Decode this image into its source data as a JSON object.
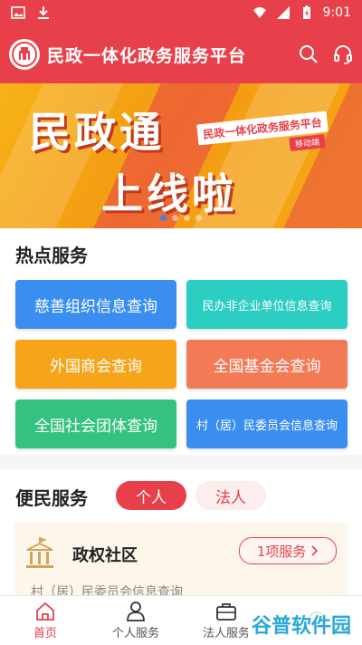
{
  "status": {
    "time": "9:01"
  },
  "header": {
    "title": "民政一体化政务服务平台"
  },
  "banner": {
    "line1": "民政通",
    "line2": "上线啦",
    "tag": "民政一体化政务服务平台",
    "sub": "移动端",
    "slide_count": 4,
    "active_slide": 1
  },
  "hot": {
    "title": "热点服务",
    "items": [
      {
        "label": "慈善组织信息查询",
        "color": "#3a8ef0"
      },
      {
        "label": "民办非企业单位信息查询",
        "color": "#2ccdc3"
      },
      {
        "label": "外国商会查询",
        "color": "#f6a51b"
      },
      {
        "label": "全国基金会查询",
        "color": "#f27a55"
      },
      {
        "label": "全国社会团体查询",
        "color": "#33c27f"
      },
      {
        "label": "村（居）民委员会信息查询",
        "color": "#3a8ef0"
      }
    ]
  },
  "convenience": {
    "title": "便民服务",
    "tabs": [
      {
        "label": "个人"
      },
      {
        "label": "法人"
      }
    ]
  },
  "community": {
    "title": "政权社区",
    "button": "1项服务",
    "sub": "村（居）民委员会信息查询"
  },
  "tabbar": {
    "items": [
      {
        "label": "首页"
      },
      {
        "label": "个人服务"
      },
      {
        "label": "法人服务"
      },
      {
        "label": ""
      }
    ]
  },
  "watermark": "谷普软件园",
  "colors": {
    "brand": "#e8404a"
  }
}
